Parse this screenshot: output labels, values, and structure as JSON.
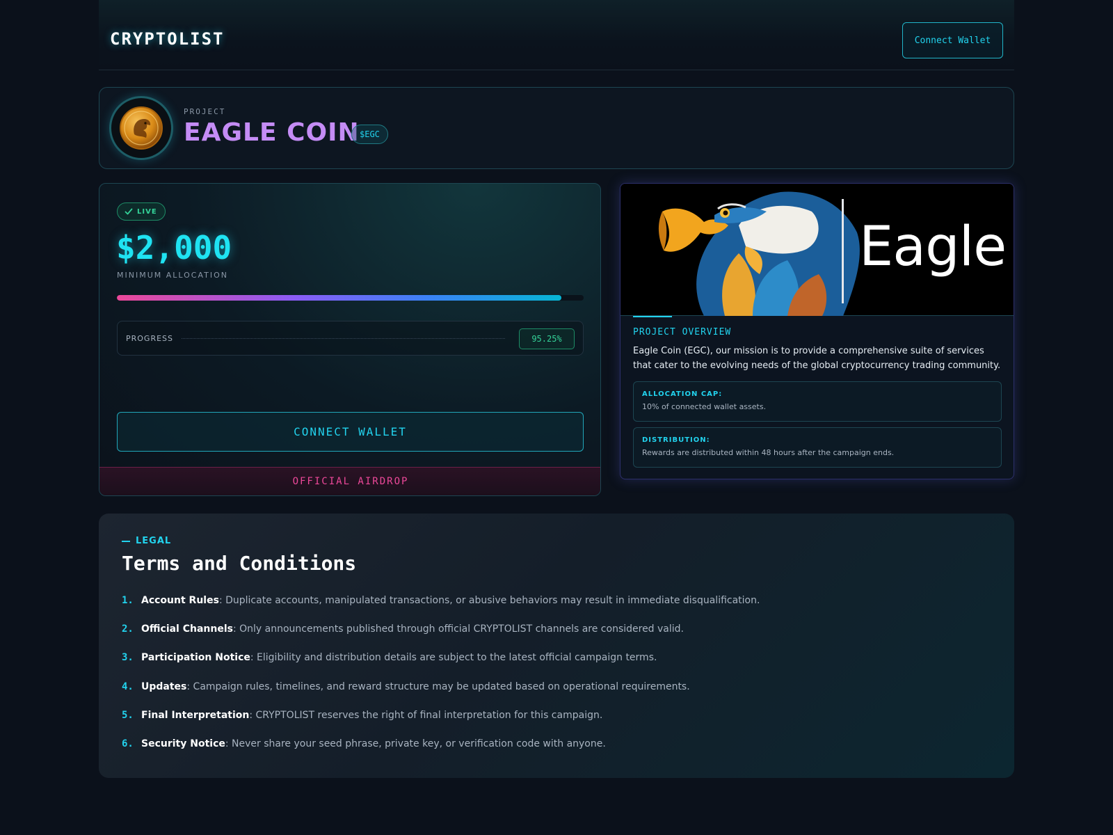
{
  "header": {
    "logo": "CRYPTOLIST",
    "connect_label": "Connect Wallet"
  },
  "project": {
    "label": "PROJECT",
    "name": "EAGLE COIN",
    "ticker": "$EGC",
    "avatar_icon": "eagle-coin-icon"
  },
  "allocation": {
    "status": "LIVE",
    "amount": "$2,000",
    "amount_label": "MINIMUM ALLOCATION",
    "progress_label": "PROGRESS",
    "progress_value": "95.25%",
    "progress_fraction": 0.9525,
    "connect_label": "CONNECT WALLET",
    "footer": "OFFICIAL AIRDROP"
  },
  "overview": {
    "hero_word": "Eagle",
    "title": "PROJECT OVERVIEW",
    "text": "Eagle Coin (EGC), our mission is to provide a comprehensive suite of services that cater to the evolving needs of the global cryptocurrency trading community.",
    "cap_label": "ALLOCATION CAP:",
    "cap_value": "10% of connected wallet assets.",
    "dist_label": "DISTRIBUTION:",
    "dist_value": "Rewards are distributed within 48 hours after the campaign ends."
  },
  "terms": {
    "eyebrow": "LEGAL",
    "title": "Terms and Conditions",
    "items": [
      {
        "num": "1.",
        "title": "Account Rules",
        "text": ": Duplicate accounts, manipulated transactions, or abusive behaviors may result in immediate disqualification."
      },
      {
        "num": "2.",
        "title": "Official Channels",
        "text": ": Only announcements published through official CRYPTOLIST channels are considered valid."
      },
      {
        "num": "3.",
        "title": "Participation Notice",
        "text": ": Eligibility and distribution details are subject to the latest official campaign terms."
      },
      {
        "num": "4.",
        "title": "Updates",
        "text": ": Campaign rules, timelines, and reward structure may be updated based on operational requirements."
      },
      {
        "num": "5.",
        "title": "Final Interpretation",
        "text": ": CRYPTOLIST reserves the right of final interpretation for this campaign."
      },
      {
        "num": "6.",
        "title": "Security Notice",
        "text": ": Never share your seed phrase, private key, or verification code with anyone."
      }
    ]
  },
  "colors": {
    "accent": "#22d3ee",
    "brand_purple": "#c48cf5",
    "success": "#34d399",
    "pink": "#ec4899",
    "background": "#0b111b"
  }
}
